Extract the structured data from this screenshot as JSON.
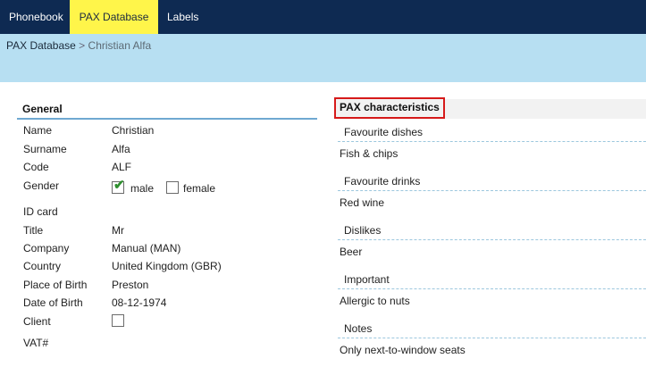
{
  "nav": {
    "tabs": [
      {
        "label": "Phonebook"
      },
      {
        "label": "PAX Database"
      },
      {
        "label": "Labels"
      }
    ]
  },
  "breadcrumb": {
    "section": "PAX Database",
    "separator": ">",
    "current": "Christian Alfa"
  },
  "general": {
    "title": "General",
    "fields": [
      {
        "label": "Name",
        "value": "Christian"
      },
      {
        "label": "Surname",
        "value": "Alfa"
      },
      {
        "label": "Code",
        "value": "ALF"
      },
      {
        "label": "Gender",
        "value": ""
      },
      {
        "label": "ID card",
        "value": ""
      },
      {
        "label": "Title",
        "value": "Mr"
      },
      {
        "label": "Company",
        "value": "Manual (MAN)"
      },
      {
        "label": "Country",
        "value": "United Kingdom (GBR)"
      },
      {
        "label": "Place of Birth",
        "value": "Preston"
      },
      {
        "label": "Date of Birth",
        "value": "08-12-1974"
      },
      {
        "label": "Client",
        "value": ""
      },
      {
        "label": "VAT#",
        "value": ""
      }
    ],
    "gender_options": [
      {
        "label": "male",
        "checked": true
      },
      {
        "label": "female",
        "checked": false
      }
    ],
    "client_checked": false
  },
  "pax": {
    "title": "PAX characteristics",
    "items": [
      {
        "heading": "Favourite dishes",
        "value": "Fish & chips"
      },
      {
        "heading": "Favourite drinks",
        "value": "Red wine"
      },
      {
        "heading": "Dislikes",
        "value": "Beer"
      },
      {
        "heading": "Important",
        "value": "Allergic to nuts"
      },
      {
        "heading": "Notes",
        "value": "Only next-to-window seats"
      }
    ]
  },
  "colors": {
    "nav_bg": "#0e2a52",
    "active_tab_bg": "#fff54a",
    "breadcrumb_bg": "#b7dff2",
    "highlight_border": "#d61a1a",
    "divider": "#6fa8d1"
  }
}
